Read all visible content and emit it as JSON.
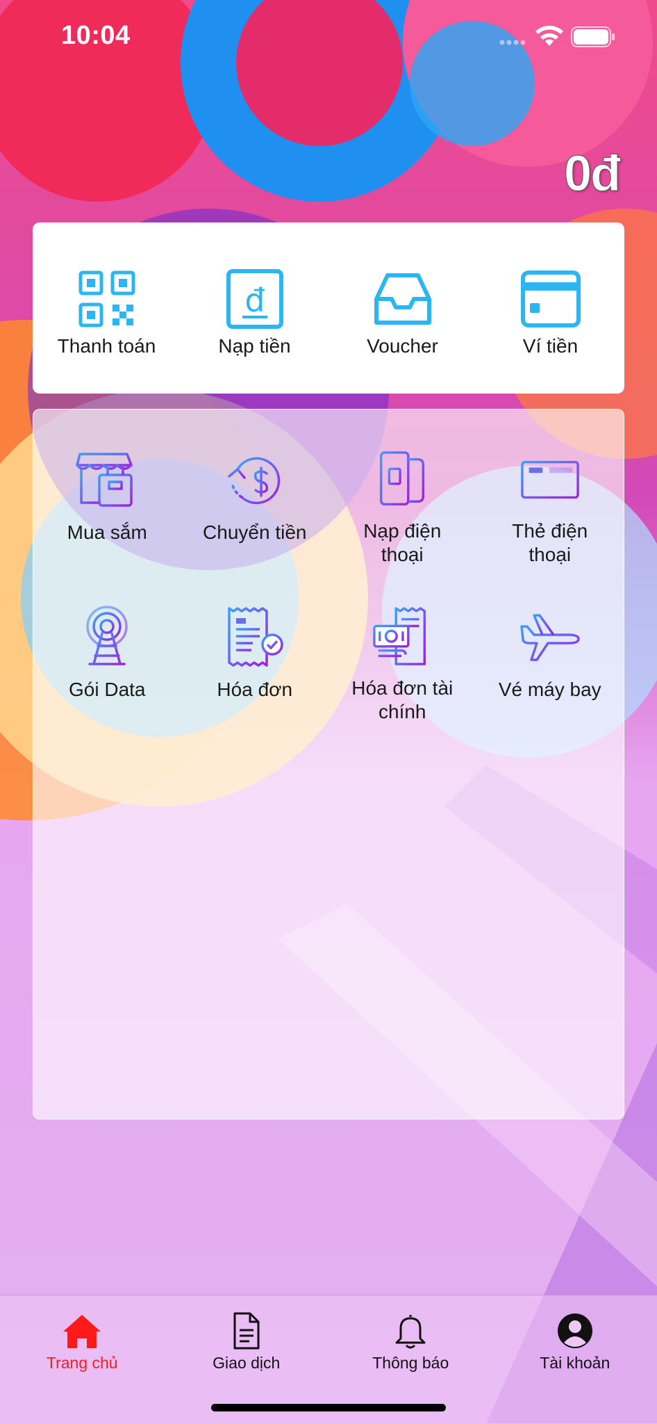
{
  "status_bar": {
    "time": "10:04"
  },
  "wallet": {
    "balance": "0đ"
  },
  "quick_actions": [
    {
      "label": "Thanh toán",
      "icon": "qr-code-icon"
    },
    {
      "label": "Nạp tiền",
      "icon": "dong-topup-icon"
    },
    {
      "label": "Voucher",
      "icon": "inbox-tray-icon"
    },
    {
      "label": "Ví tiền",
      "icon": "card-wallet-icon"
    }
  ],
  "services": [
    {
      "label": "Mua sắm",
      "icon": "shop-icon"
    },
    {
      "label": "Chuyển tiền",
      "icon": "money-transfer-icon"
    },
    {
      "label": "Nạp điện thoại",
      "icon": "phone-topup-icon"
    },
    {
      "label": "Thẻ điện thoại",
      "icon": "phone-card-icon"
    },
    {
      "label": "Gói Data",
      "icon": "antenna-icon"
    },
    {
      "label": "Hóa đơn",
      "icon": "bill-icon"
    },
    {
      "label": "Hóa đơn tài chính",
      "icon": "finance-bill-icon"
    },
    {
      "label": "Vé máy bay",
      "icon": "airplane-icon"
    }
  ],
  "tab_bar": [
    {
      "label": "Trang chủ",
      "icon": "home-icon",
      "active": true
    },
    {
      "label": "Giao dịch",
      "icon": "document-icon",
      "active": false
    },
    {
      "label": "Thông báo",
      "icon": "bell-icon",
      "active": false
    },
    {
      "label": "Tài khoản",
      "icon": "account-icon",
      "active": false
    }
  ],
  "colors": {
    "accent_blue": "#2bb5f2",
    "service_purple": "#7a2be0",
    "tab_active": "#ff1a1a",
    "background": "#e9b8f0"
  }
}
